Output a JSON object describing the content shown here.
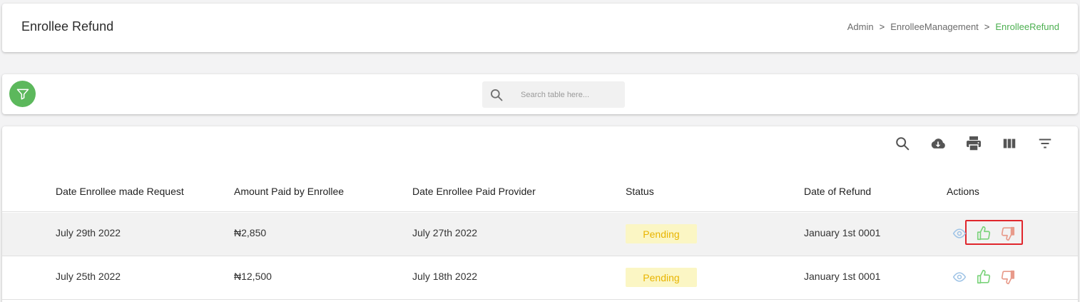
{
  "header": {
    "title": "Enrollee Refund",
    "breadcrumb": [
      {
        "label": "Admin"
      },
      {
        "label": "EnrolleeManagement"
      },
      {
        "label": "EnrolleeRefund"
      }
    ],
    "breadcrumb_separator": ">"
  },
  "filter_bar": {
    "filter_icon": "funnel-icon",
    "search": {
      "placeholder": "Search table here...",
      "value": "",
      "icon": "search-icon"
    }
  },
  "toolbar": {
    "icons": [
      "search-icon",
      "cloud-download-icon",
      "print-icon",
      "columns-icon",
      "filter-list-icon"
    ]
  },
  "table": {
    "columns": [
      "Date Enrollee made Request",
      "Amount Paid by Enrollee",
      "Date Enrollee Paid Provider",
      "Status",
      "Date of Refund",
      "Actions"
    ],
    "rows": [
      {
        "request_date": "July 29th 2022",
        "amount": "₦2,850",
        "paid_provider_date": "July 27th 2022",
        "status": "Pending",
        "refund_date": "January 1st 0001",
        "actions": [
          "eye-icon",
          "thumbs-up-icon",
          "thumbs-down-icon"
        ]
      },
      {
        "request_date": "July 25th 2022",
        "amount": "₦12,500",
        "paid_provider_date": "July 18th 2022",
        "status": "Pending",
        "refund_date": "January 1st 0001",
        "actions": [
          "eye-icon",
          "thumbs-up-icon",
          "thumbs-down-icon"
        ]
      }
    ]
  },
  "colors": {
    "accent_green": "#5cb85c",
    "breadcrumb_active": "#4caf50",
    "pending_bg": "#fbf6c4",
    "pending_text": "#e8b400",
    "view_icon": "#9ec3e6",
    "approve_icon": "#7bd37b",
    "reject_icon": "#e89a8a",
    "highlight_border": "#e0262c"
  }
}
